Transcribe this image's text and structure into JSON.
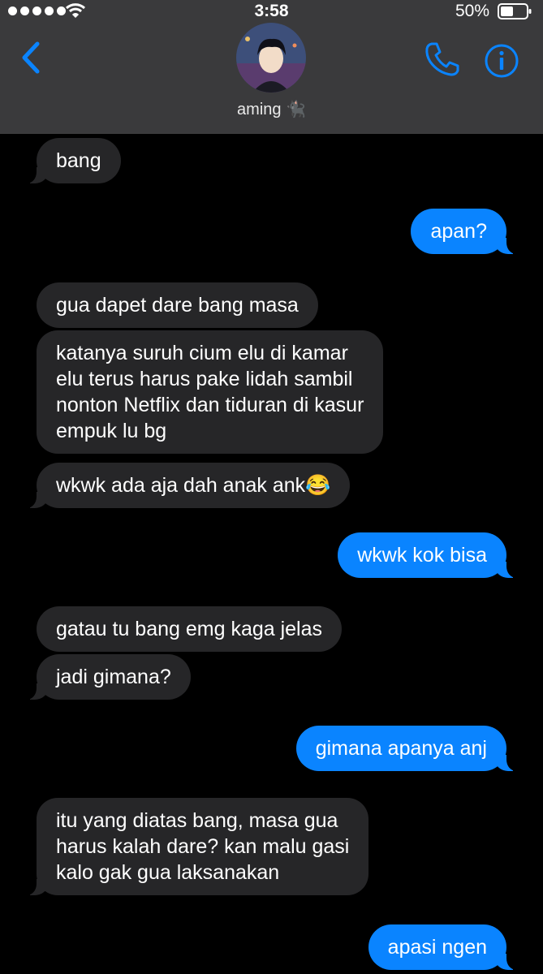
{
  "status_bar": {
    "time": "3:58",
    "battery": "50%"
  },
  "header": {
    "contact_name": "aming 🐈‍⬛"
  },
  "colors": {
    "accent": "#0a84ff",
    "incoming_bubble": "#262628",
    "header_bg": "#3a3a3c"
  },
  "messages": [
    {
      "from": "them",
      "text": "bang"
    },
    {
      "from": "me",
      "text": "apan?"
    },
    {
      "from": "them",
      "text": "gua dapet dare bang masa"
    },
    {
      "from": "them",
      "lines": [
        "katanya suruh cium elu di kamar",
        "elu terus harus pake lidah sambil",
        "nonton Netflix dan tiduran di kasur",
        "empuk lu bg"
      ]
    },
    {
      "from": "them",
      "text": "wkwk ada aja dah anak ank😂"
    },
    {
      "from": "me",
      "text": "wkwk kok bisa"
    },
    {
      "from": "them",
      "text": "gatau tu bang emg kaga jelas"
    },
    {
      "from": "them",
      "text": "jadi gimana?"
    },
    {
      "from": "me",
      "text": "gimana apanya anj"
    },
    {
      "from": "them",
      "lines": [
        "itu yang diatas bang, masa gua",
        "harus kalah dare? kan malu gasi",
        "kalo gak gua laksanakan"
      ]
    },
    {
      "from": "me",
      "text": "apasi ngen"
    }
  ]
}
